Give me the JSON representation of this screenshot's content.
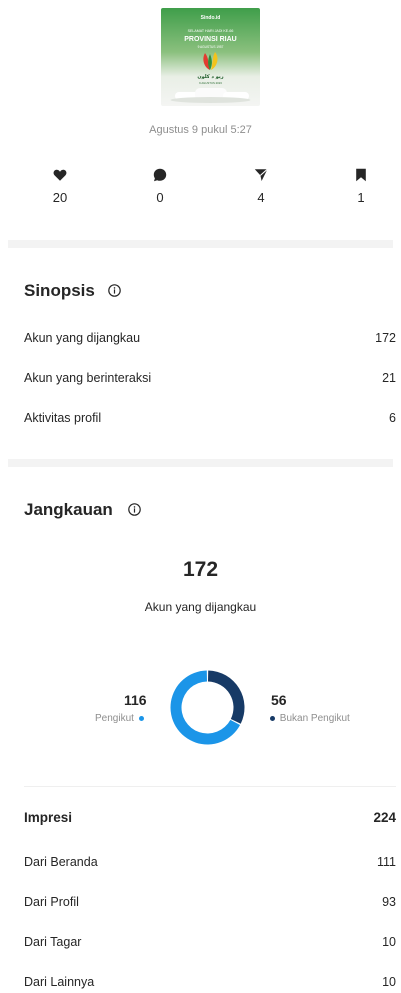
{
  "post": {
    "thumbnail": {
      "brand": "Sindo.id",
      "subtitle": "SELAMAT HARI JADI KE-66",
      "title": "PROVINSI RIAU",
      "tagline": "9 AGUSTUS 1957",
      "arabic": "ريو د كلون",
      "footer": "9 AGUSTUS 2023"
    },
    "date": "Agustus 9 pukul 5:27"
  },
  "stats": [
    {
      "icon": "heart-icon",
      "value": "20"
    },
    {
      "icon": "comment-icon",
      "value": "0"
    },
    {
      "icon": "send-icon",
      "value": "4"
    },
    {
      "icon": "bookmark-icon",
      "value": "1"
    }
  ],
  "sinopsis": {
    "title": "Sinopsis",
    "rows": [
      {
        "label": "Akun yang dijangkau",
        "value": "172"
      },
      {
        "label": "Akun yang berinteraksi",
        "value": "21"
      },
      {
        "label": "Aktivitas profil",
        "value": "6"
      }
    ]
  },
  "jangkauan": {
    "title": "Jangkauan",
    "total": "172",
    "total_label": "Akun yang dijangkau",
    "followers": {
      "value": "116",
      "label": "Pengikut",
      "color": "#1b95e8"
    },
    "non_followers": {
      "value": "56",
      "label": "Bukan Pengikut",
      "color": "#173a66"
    }
  },
  "impresi": {
    "title": "Impresi",
    "total": "224",
    "rows": [
      {
        "label": "Dari Beranda",
        "value": "111"
      },
      {
        "label": "Dari Profil",
        "value": "93"
      },
      {
        "label": "Dari Tagar",
        "value": "10"
      },
      {
        "label": "Dari Lainnya",
        "value": "10"
      }
    ]
  },
  "colors": {
    "followers": "#1b95e8",
    "non_followers": "#173a66",
    "text": "#262626",
    "muted": "#8e8e8e"
  }
}
